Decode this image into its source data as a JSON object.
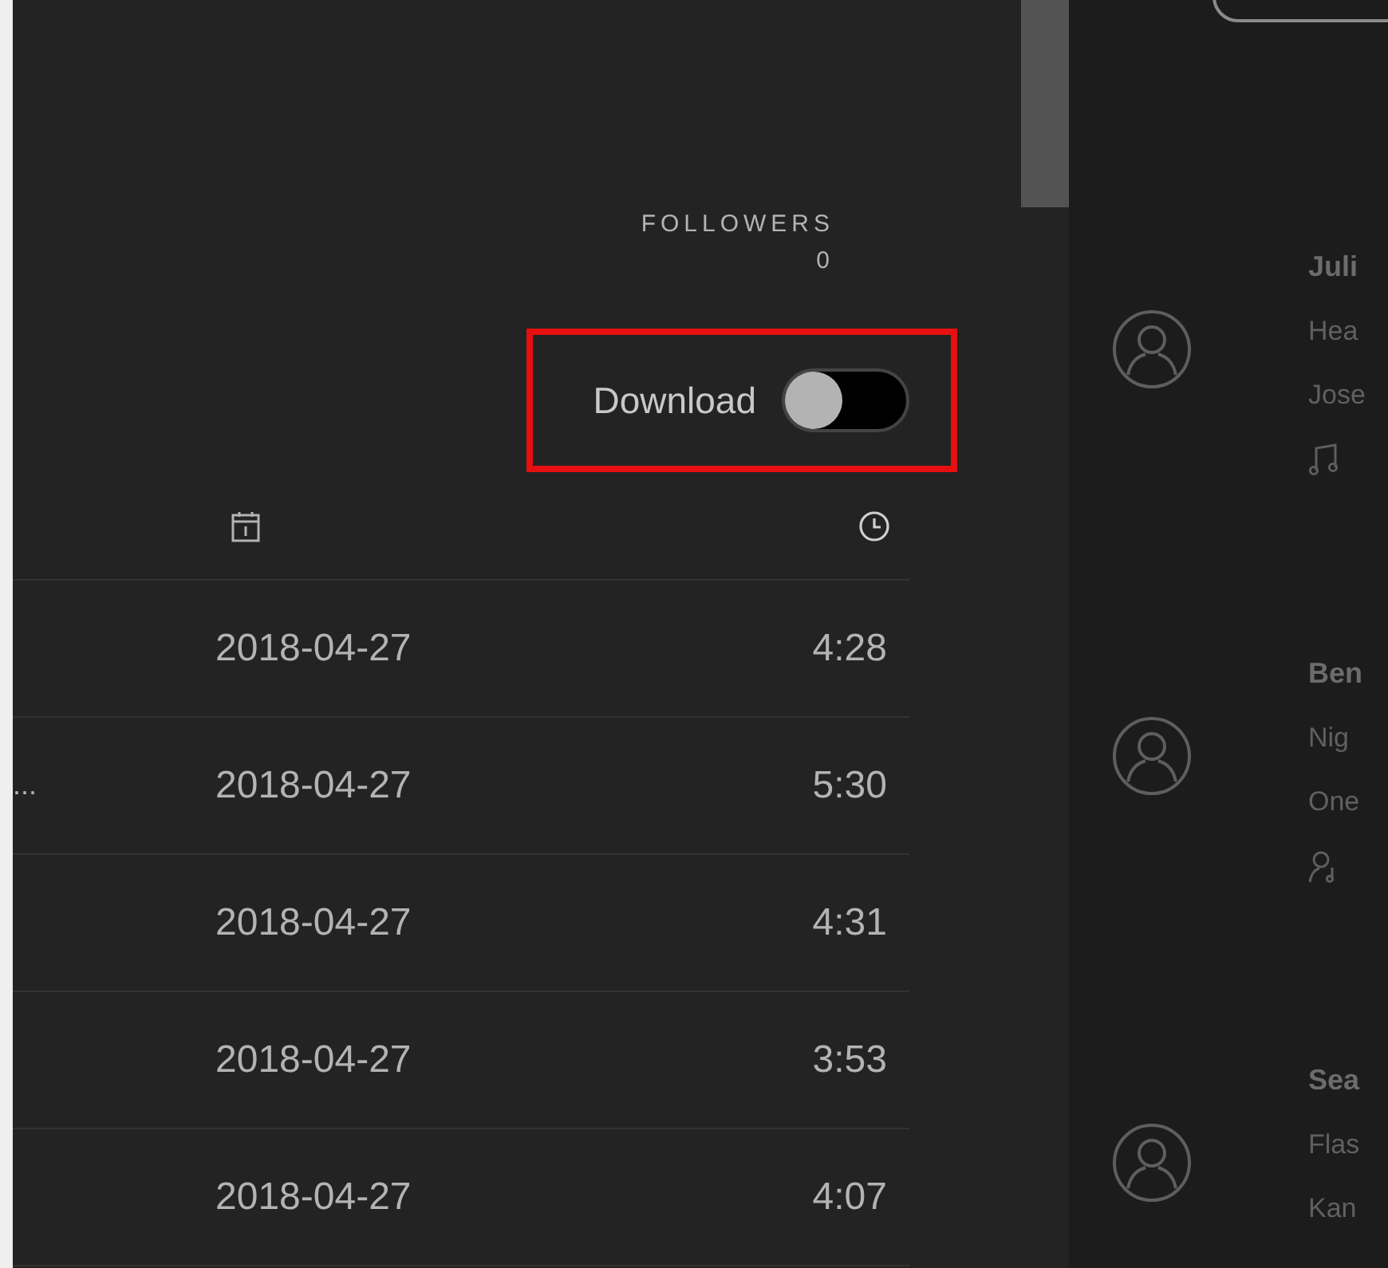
{
  "profile": {
    "followers_label": "FOLLOWERS",
    "followers_count": "0",
    "download": {
      "label": "Download",
      "on": false
    }
  },
  "table": {
    "rows": [
      {
        "date": "2018-04-27",
        "duration": "4:28"
      },
      {
        "title": "...",
        "date": "2018-04-27",
        "duration": "5:30"
      },
      {
        "date": "2018-04-27",
        "duration": "4:31"
      },
      {
        "date": "2018-04-27",
        "duration": "3:53"
      },
      {
        "date": "2018-04-27",
        "duration": "4:07"
      }
    ]
  },
  "friend_activity": [
    {
      "name": "Juli",
      "track": "Hea",
      "artist": "Jose",
      "kind": "playlist"
    },
    {
      "name": "Ben",
      "track": "Nig",
      "artist": "One",
      "kind": "artist"
    },
    {
      "name": "Sea",
      "track": "Flas",
      "artist": "Kan"
    }
  ]
}
